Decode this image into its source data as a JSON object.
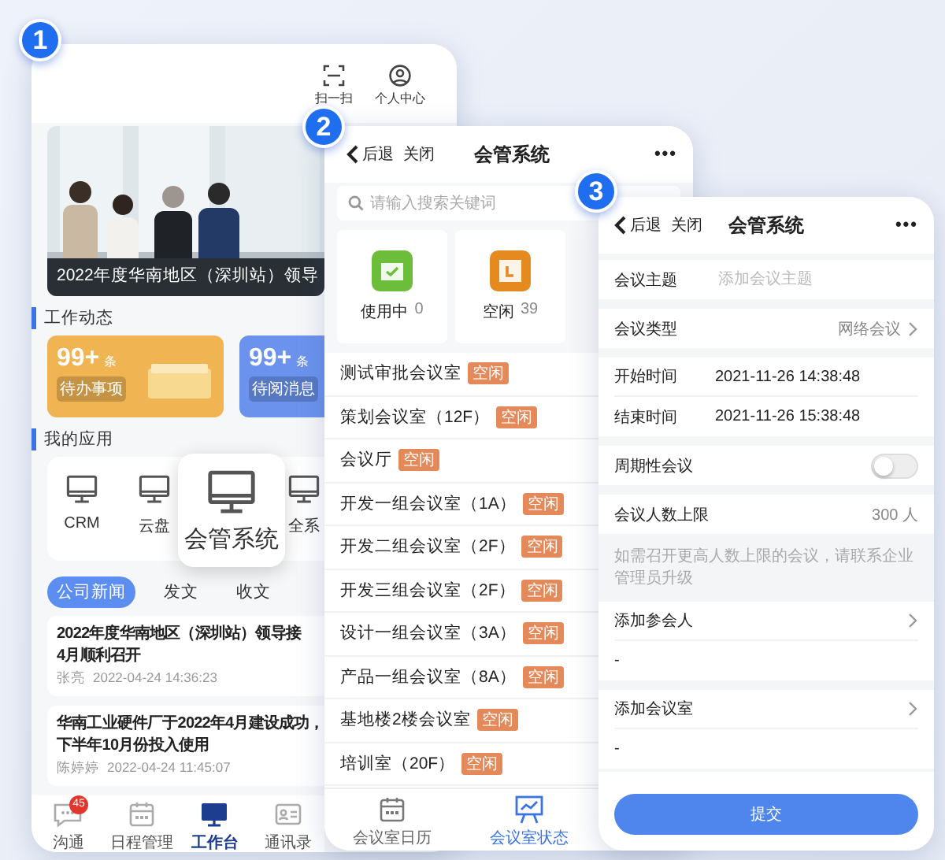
{
  "steps": [
    "1",
    "2",
    "3"
  ],
  "home": {
    "top_actions": [
      {
        "label": "扫一扫"
      },
      {
        "label": "个人中心"
      }
    ],
    "banner": {
      "kind": "picture",
      "caption": "2022年度华南地区（深圳站）领导"
    },
    "work_section": "工作动态",
    "work_cards": [
      {
        "count": "99+",
        "unit": "条",
        "label": "待办事项",
        "color": "#f0b452"
      },
      {
        "count": "99+",
        "unit": "条",
        "label": "待阅消息",
        "color": "#6b93ee"
      }
    ],
    "apps_section": "我的应用",
    "apps": [
      {
        "label": "CRM",
        "raised": false
      },
      {
        "label": "云盘",
        "raised": false
      },
      {
        "label": "会管系统",
        "raised": true
      },
      {
        "label": "全系",
        "raised": false
      }
    ],
    "news_tabs": [
      {
        "label": "公司新闻",
        "selected": true
      },
      {
        "label": "发文",
        "selected": false
      },
      {
        "label": "收文",
        "selected": false
      }
    ],
    "news": [
      {
        "title_lines": [
          "2022年度华南地区（深圳站）领导接",
          "4月顺利召开"
        ],
        "author": "张亮",
        "time": "2022-04-24 14:36:23"
      },
      {
        "title_lines": [
          "华南工业硬件厂于2022年4月建设成功，",
          "下半年10月份投入使用"
        ],
        "author": "陈婷婷",
        "time": "2022-04-24 11:45:07"
      }
    ],
    "tab_bar": [
      {
        "label": "沟通",
        "badge": "45",
        "selected": false
      },
      {
        "label": "日程管理",
        "selected": false
      },
      {
        "label": "工作台",
        "selected": true
      },
      {
        "label": "通讯录",
        "selected": false
      }
    ]
  },
  "rooms_screen": {
    "nav": {
      "back": "后退",
      "close": "关闭",
      "title": "会管系统",
      "more": "•••"
    },
    "search": {
      "placeholder": "请输入搜索关键词"
    },
    "status_cards": [
      {
        "label": "使用中",
        "count": "0",
        "color": "#6cbd3a"
      },
      {
        "label": "空闲",
        "count": "39",
        "color": "#e58a1e"
      }
    ],
    "rooms": [
      {
        "name": "测试审批会议室",
        "status": "空闲"
      },
      {
        "name": "策划会议室（12F）",
        "status": "空闲"
      },
      {
        "name": "会议厅",
        "status": "空闲"
      },
      {
        "name": "开发一组会议室（1A）",
        "status": "空闲"
      },
      {
        "name": "开发二组会议室（2F）",
        "status": "空闲"
      },
      {
        "name": "开发三组会议室（2F）",
        "status": "空闲"
      },
      {
        "name": "设计一组会议室（3A）",
        "status": "空闲"
      },
      {
        "name": "产品一组会议室（8A）",
        "status": "空闲"
      },
      {
        "name": "基地楼2楼会议室",
        "status": "空闲"
      },
      {
        "name": "培训室（20F）",
        "status": "空闲"
      }
    ],
    "tab_bar": [
      {
        "label": "会议室日历",
        "selected": false
      },
      {
        "label": "会议室状态",
        "selected": true
      }
    ]
  },
  "booking_screen": {
    "nav": {
      "back": "后退",
      "close": "关闭",
      "title": "会管系统",
      "more": "•••"
    },
    "form_sections": [
      [
        {
          "kind": "input",
          "label": "会议主题",
          "placeholder": "添加会议主题"
        }
      ],
      [
        {
          "kind": "select",
          "label": "会议类型",
          "value": "网络会议"
        }
      ],
      [
        {
          "kind": "text",
          "label": "开始时间",
          "value": "2021-11-26 14:38:48"
        },
        {
          "kind": "text",
          "label": "结束时间",
          "value": "2021-11-26 15:38:48"
        }
      ],
      [
        {
          "kind": "switch",
          "label": "周期性会议",
          "on": false
        }
      ],
      [
        {
          "kind": "count",
          "label": "会议人数上限",
          "value": "300 人"
        }
      ],
      [
        {
          "kind": "note",
          "text": "如需召开更高人数上限的会议，请联系企业管理员升级"
        }
      ],
      [
        {
          "kind": "picker",
          "label": "添加参会人"
        },
        {
          "kind": "empty",
          "value": "-"
        }
      ],
      [
        {
          "kind": "picker",
          "label": "添加会议室"
        },
        {
          "kind": "empty",
          "value": "-"
        }
      ]
    ],
    "submit": "提交"
  }
}
